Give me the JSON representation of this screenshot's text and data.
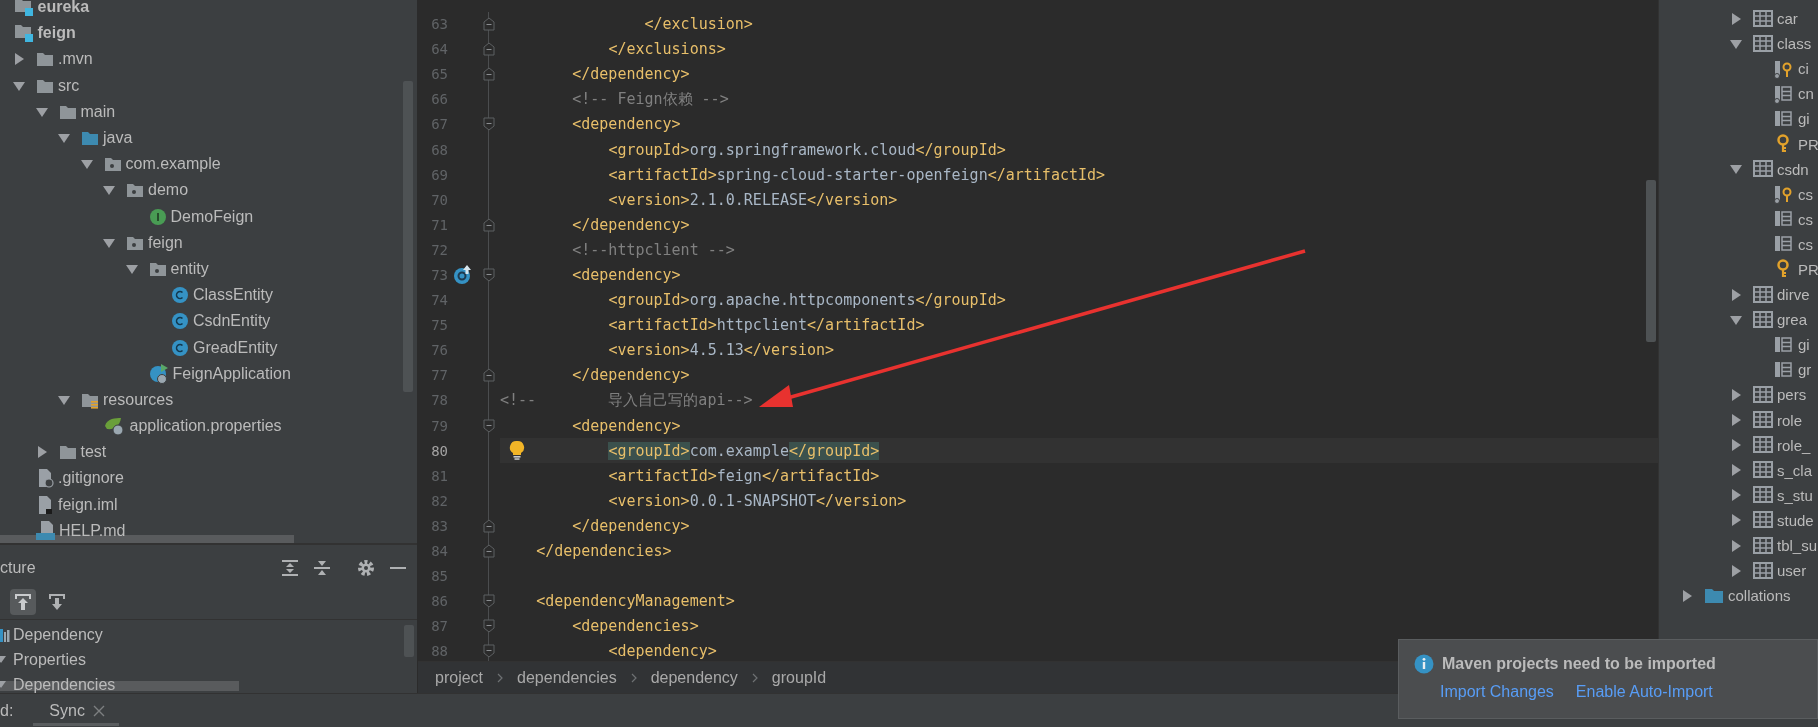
{
  "project_tree": [
    {
      "label": "eureka",
      "kind": "module"
    },
    {
      "label": "feign",
      "kind": "module",
      "children": [
        {
          "label": ".mvn",
          "kind": "folder",
          "expanded": false
        },
        {
          "label": "src",
          "kind": "folder",
          "expanded": true,
          "children": [
            {
              "label": "main",
              "kind": "folder",
              "expanded": true,
              "children": [
                {
                  "label": "java",
                  "kind": "source-root",
                  "expanded": true,
                  "children": [
                    {
                      "label": "com.example",
                      "kind": "package",
                      "expanded": true,
                      "children": [
                        {
                          "label": "demo",
                          "kind": "package",
                          "expanded": true,
                          "children": [
                            {
                              "label": "DemoFeign",
                              "kind": "interface"
                            }
                          ]
                        },
                        {
                          "label": "feign",
                          "kind": "package",
                          "expanded": true,
                          "children": [
                            {
                              "label": "entity",
                              "kind": "package",
                              "expanded": true,
                              "children": [
                                {
                                  "label": "ClassEntity",
                                  "kind": "class"
                                },
                                {
                                  "label": "CsdnEntity",
                                  "kind": "class"
                                },
                                {
                                  "label": "GreadEntity",
                                  "kind": "class"
                                }
                              ]
                            },
                            {
                              "label": "FeignApplication",
                              "kind": "spring-app"
                            }
                          ]
                        }
                      ]
                    }
                  ]
                },
                {
                  "label": "resources",
                  "kind": "resources-root",
                  "expanded": true,
                  "children": [
                    {
                      "label": "application.properties",
                      "kind": "spring-properties"
                    }
                  ]
                }
              ]
            },
            {
              "label": "test",
              "kind": "folder",
              "expanded": false
            }
          ]
        },
        {
          "label": ".gitignore",
          "kind": "ignore-file"
        },
        {
          "label": "feign.iml",
          "kind": "iml-file"
        },
        {
          "label": "HELP.md",
          "kind": "md-file"
        }
      ]
    }
  ],
  "structure_panel": {
    "title": "cture",
    "items": [
      {
        "label": "Dependency",
        "kind": "element"
      },
      {
        "label": "Properties",
        "kind": "node"
      },
      {
        "label": "Dependencies",
        "kind": "node"
      }
    ]
  },
  "bottom_bar": {
    "label": "d:",
    "tabs": [
      {
        "label": "Sync",
        "selected": true
      }
    ]
  },
  "editor": {
    "lines": [
      {
        "number": "63",
        "text": "                </exclusion>",
        "kind": "code",
        "fold": {
          "kind": "end"
        },
        "current": false
      },
      {
        "number": "64",
        "text": "            </exclusions>",
        "kind": "code",
        "fold": {
          "kind": "end"
        },
        "current": false
      },
      {
        "number": "65",
        "text": "        </dependency>",
        "kind": "code",
        "fold": {
          "kind": "end"
        },
        "current": false
      },
      {
        "number": "66",
        "text": "        <!-- Feign依赖 -->",
        "kind": "comment",
        "current": false
      },
      {
        "number": "67",
        "text": "        <dependency>",
        "kind": "code",
        "fold": {
          "kind": "start"
        },
        "current": false
      },
      {
        "number": "68",
        "text": "            <groupId>org.springframework.cloud</groupId>",
        "kind": "code",
        "current": false
      },
      {
        "number": "69",
        "text": "            <artifactId>spring-cloud-starter-openfeign</artifactId>",
        "kind": "code",
        "current": false
      },
      {
        "number": "70",
        "text": "            <version>2.1.0.RELEASE</version>",
        "kind": "code",
        "current": false
      },
      {
        "number": "71",
        "text": "        </dependency>",
        "kind": "code",
        "fold": {
          "kind": "end"
        },
        "current": false
      },
      {
        "number": "72",
        "text": "        <!--httpclient -->",
        "kind": "comment",
        "current": false
      },
      {
        "number": "73",
        "text": "        <dependency>",
        "kind": "code",
        "fold": {
          "kind": "start"
        },
        "gutter_icon": {
          "kind": "sync"
        },
        "current": false
      },
      {
        "number": "74",
        "text": "            <groupId>org.apache.httpcomponents</groupId>",
        "kind": "code",
        "current": false
      },
      {
        "number": "75",
        "text": "            <artifactId>httpclient</artifactId>",
        "kind": "code",
        "current": false
      },
      {
        "number": "76",
        "text": "            <version>4.5.13</version>",
        "kind": "code",
        "current": false
      },
      {
        "number": "77",
        "text": "        </dependency>",
        "kind": "code",
        "fold": {
          "kind": "end"
        },
        "current": false
      },
      {
        "number": "78",
        "text": "<!--        导入自己写的api-->",
        "kind": "comment",
        "current": false
      },
      {
        "number": "79",
        "text": "        <dependency>",
        "kind": "code",
        "fold": {
          "kind": "start"
        },
        "current": false
      },
      {
        "number": "80",
        "text": "            <groupId>com.example</groupId>",
        "kind": "code",
        "gutter_icon": {
          "kind": "bulb"
        },
        "current": true
      },
      {
        "number": "81",
        "text": "            <artifactId>feign</artifactId>",
        "kind": "code",
        "current": false
      },
      {
        "number": "82",
        "text": "            <version>0.0.1-SNAPSHOT</version>",
        "kind": "code",
        "current": false
      },
      {
        "number": "83",
        "text": "        </dependency>",
        "kind": "code",
        "fold": {
          "kind": "end"
        },
        "current": false
      },
      {
        "number": "84",
        "text": "    </dependencies>",
        "kind": "code",
        "fold": {
          "kind": "end"
        },
        "current": false
      },
      {
        "number": "85",
        "current": false
      },
      {
        "number": "86",
        "text": "    <dependencyManagement>",
        "kind": "code",
        "fold": {
          "kind": "start"
        },
        "current": false
      },
      {
        "number": "87",
        "text": "        <dependencies>",
        "kind": "code",
        "fold": {
          "kind": "start"
        },
        "current": false
      },
      {
        "number": "88",
        "text": "            <dependency>",
        "kind": "code",
        "fold": {
          "kind": "start"
        },
        "current": false
      }
    ],
    "breadcrumbs": [
      "project",
      "dependencies",
      "dependency",
      "groupId"
    ]
  },
  "database_tree": {
    "tables": [
      {
        "label": "car",
        "expanded": false
      },
      {
        "label": "class",
        "expanded": true,
        "children": [
          {
            "label": "ci",
            "kind": "key-column"
          },
          {
            "label": "cn",
            "kind": "indexed-column"
          },
          {
            "label": "gi",
            "kind": "column"
          },
          {
            "label": "PR",
            "kind": "key"
          }
        ]
      },
      {
        "label": "csdn",
        "expanded": true,
        "children": [
          {
            "label": "cs",
            "kind": "key-column"
          },
          {
            "label": "cs",
            "kind": "column"
          },
          {
            "label": "cs",
            "kind": "column"
          },
          {
            "label": "PR",
            "kind": "key"
          }
        ]
      },
      {
        "label": "dirve",
        "expanded": false
      },
      {
        "label": "grea",
        "expanded": true,
        "children": [
          {
            "label": "gi",
            "kind": "column"
          },
          {
            "label": "gr",
            "kind": "column"
          }
        ]
      },
      {
        "label": "pers",
        "expanded": false
      },
      {
        "label": "role",
        "expanded": false
      },
      {
        "label": "role_",
        "expanded": false
      },
      {
        "label": "s_cla",
        "expanded": false
      },
      {
        "label": "s_stu",
        "expanded": false
      },
      {
        "label": "stude",
        "expanded": false
      },
      {
        "label": "tbl_su",
        "expanded": false
      },
      {
        "label": "user",
        "expanded": false
      }
    ],
    "folders": [
      {
        "label": "collations",
        "expanded": false
      }
    ]
  },
  "notification": {
    "title": "Maven projects need to be imported",
    "actions": [
      "Import Changes",
      "Enable Auto-Import"
    ]
  }
}
